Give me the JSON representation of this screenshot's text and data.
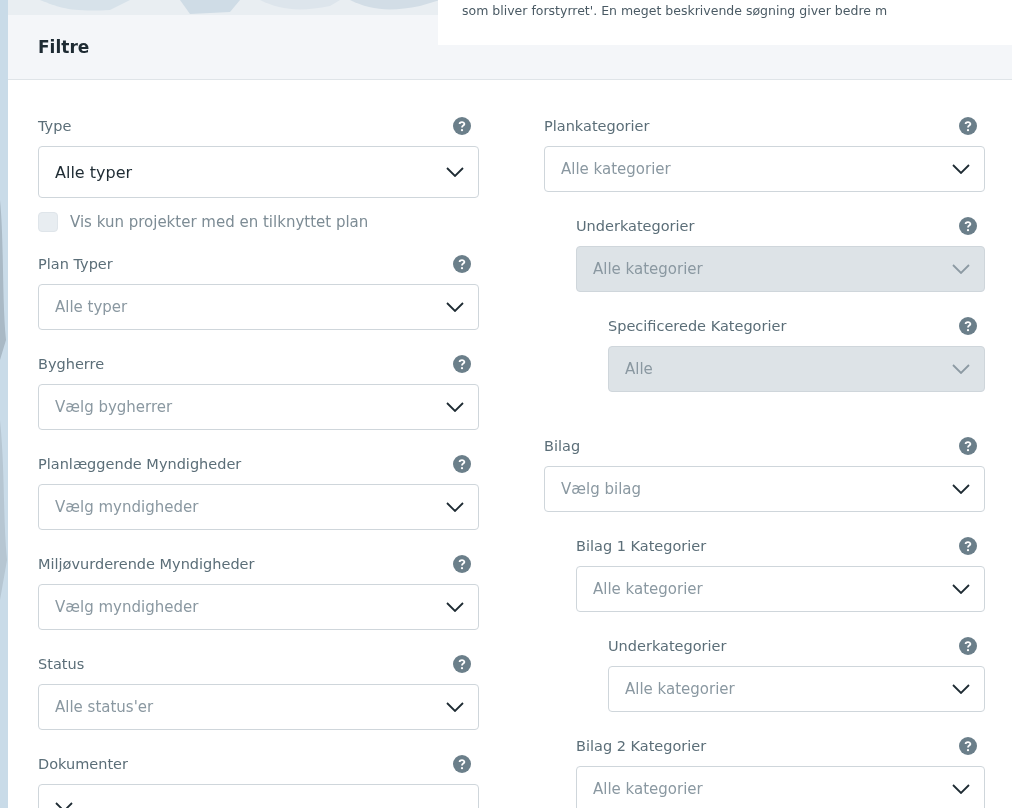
{
  "background_notice": {
    "text": "som bliver forstyrret'. En meget beskrivende søgning giver bedre m"
  },
  "modal": {
    "title": "Filtre",
    "left": [
      {
        "kind": "select",
        "label": "Type",
        "value": "Alle typer",
        "disabled": false
      },
      {
        "kind": "checkbox",
        "label": "Vis kun projekter med en tilknyttet plan",
        "checked": false
      },
      {
        "kind": "select",
        "label": "Plan Typer",
        "placeholder": "Alle typer",
        "disabled": false
      },
      {
        "kind": "select",
        "label": "Bygherre",
        "placeholder": "Vælg bygherrer",
        "disabled": false
      },
      {
        "kind": "select",
        "label": "Planlæggende Myndigheder",
        "placeholder": "Vælg myndigheder",
        "disabled": false
      },
      {
        "kind": "select",
        "label": "Miljøvurderende Myndigheder",
        "placeholder": "Vælg myndigheder",
        "disabled": false
      },
      {
        "kind": "select",
        "label": "Status",
        "placeholder": "Alle status'er",
        "disabled": false
      },
      {
        "kind": "select",
        "label": "Dokumenter",
        "disabled": false
      }
    ],
    "right": [
      {
        "kind": "select",
        "label": "Plankategorier",
        "placeholder": "Alle kategorier",
        "disabled": false,
        "children": [
          {
            "kind": "select",
            "label": "Underkategorier",
            "placeholder": "Alle kategorier",
            "disabled": true,
            "children": [
              {
                "kind": "select",
                "label": "Specificerede Kategorier",
                "placeholder": "Alle",
                "disabled": true
              }
            ]
          }
        ]
      },
      {
        "kind": "select",
        "label": "Bilag",
        "placeholder": "Vælg bilag",
        "disabled": false,
        "children": [
          {
            "kind": "select",
            "label": "Bilag 1 Kategorier",
            "placeholder": "Alle kategorier",
            "disabled": false,
            "children": [
              {
                "kind": "select",
                "label": "Underkategorier",
                "placeholder": "Alle kategorier",
                "disabled": false
              }
            ]
          },
          {
            "kind": "select",
            "label": "Bilag 2 Kategorier",
            "placeholder": "Alle kategorier",
            "disabled": false
          }
        ]
      }
    ]
  }
}
